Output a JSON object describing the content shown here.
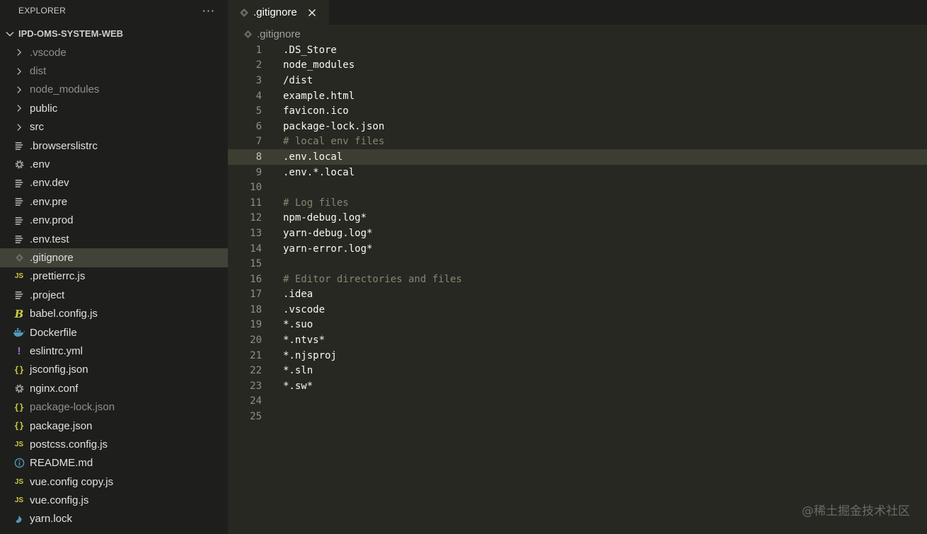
{
  "explorer": {
    "title": "EXPLORER",
    "more": "···",
    "project": "IPD-OMS-SYSTEM-WEB",
    "items": [
      {
        "label": ".vscode",
        "icon": "chevron-right-icon",
        "dim": true
      },
      {
        "label": "dist",
        "icon": "chevron-right-icon",
        "dim": true
      },
      {
        "label": "node_modules",
        "icon": "chevron-right-icon",
        "dim": true
      },
      {
        "label": "public",
        "icon": "chevron-right-icon",
        "dim": false
      },
      {
        "label": "src",
        "icon": "chevron-right-icon",
        "dim": false
      },
      {
        "label": ".browserslistrc",
        "icon": "lines-icon",
        "dim": false
      },
      {
        "label": ".env",
        "icon": "gear-icon",
        "dim": false
      },
      {
        "label": ".env.dev",
        "icon": "lines-icon",
        "dim": false
      },
      {
        "label": ".env.pre",
        "icon": "lines-icon",
        "dim": false
      },
      {
        "label": ".env.prod",
        "icon": "lines-icon",
        "dim": false
      },
      {
        "label": ".env.test",
        "icon": "lines-icon",
        "dim": false
      },
      {
        "label": ".gitignore",
        "icon": "git-diamond-icon",
        "dim": false,
        "selected": true
      },
      {
        "label": ".prettierrc.js",
        "icon": "js-icon",
        "dim": false
      },
      {
        "label": ".project",
        "icon": "lines-icon",
        "dim": false
      },
      {
        "label": "babel.config.js",
        "icon": "babel-icon",
        "dim": false
      },
      {
        "label": "Dockerfile",
        "icon": "docker-whale-icon",
        "dim": false
      },
      {
        "label": "eslintrc.yml",
        "icon": "exclamation-icon",
        "dim": false
      },
      {
        "label": "jsconfig.json",
        "icon": "json-braces-icon",
        "dim": false
      },
      {
        "label": "nginx.conf",
        "icon": "gear-icon",
        "dim": false
      },
      {
        "label": "package-lock.json",
        "icon": "json-braces-icon",
        "dim": true
      },
      {
        "label": "package.json",
        "icon": "json-braces-icon",
        "dim": false
      },
      {
        "label": "postcss.config.js",
        "icon": "js-icon",
        "dim": false
      },
      {
        "label": "README.md",
        "icon": "info-icon",
        "dim": false
      },
      {
        "label": "vue.config copy.js",
        "icon": "js-icon",
        "dim": false
      },
      {
        "label": "vue.config.js",
        "icon": "js-icon",
        "dim": false
      },
      {
        "label": "yarn.lock",
        "icon": "yarn-icon",
        "dim": false
      }
    ]
  },
  "icon_glyphs": {
    "js": "JS",
    "json": "{}",
    "bang": "!",
    "babel": "B"
  },
  "editor": {
    "tab_label": ".gitignore",
    "breadcrumb": ".gitignore",
    "current_line": 8,
    "lines": [
      {
        "n": "1",
        "text": ".DS_Store",
        "comment": false
      },
      {
        "n": "2",
        "text": "node_modules",
        "comment": false
      },
      {
        "n": "3",
        "text": "/dist",
        "comment": false
      },
      {
        "n": "4",
        "text": "example.html",
        "comment": false
      },
      {
        "n": "5",
        "text": "favicon.ico",
        "comment": false
      },
      {
        "n": "6",
        "text": "package-lock.json",
        "comment": false
      },
      {
        "n": "7",
        "text": "# local env files",
        "comment": true
      },
      {
        "n": "8",
        "text": ".env.local",
        "comment": false
      },
      {
        "n": "9",
        "text": ".env.*.local",
        "comment": false
      },
      {
        "n": "10",
        "text": "",
        "comment": false
      },
      {
        "n": "11",
        "text": "# Log files",
        "comment": true
      },
      {
        "n": "12",
        "text": "npm-debug.log*",
        "comment": false
      },
      {
        "n": "13",
        "text": "yarn-debug.log*",
        "comment": false
      },
      {
        "n": "14",
        "text": "yarn-error.log*",
        "comment": false
      },
      {
        "n": "15",
        "text": "",
        "comment": false
      },
      {
        "n": "16",
        "text": "# Editor directories and files",
        "comment": true
      },
      {
        "n": "17",
        "text": ".idea",
        "comment": false
      },
      {
        "n": "18",
        "text": ".vscode",
        "comment": false
      },
      {
        "n": "19",
        "text": "*.suo",
        "comment": false
      },
      {
        "n": "20",
        "text": "*.ntvs*",
        "comment": false
      },
      {
        "n": "21",
        "text": "*.njsproj",
        "comment": false
      },
      {
        "n": "22",
        "text": "*.sln",
        "comment": false
      },
      {
        "n": "23",
        "text": "*.sw*",
        "comment": false
      },
      {
        "n": "24",
        "text": "",
        "comment": false
      },
      {
        "n": "25",
        "text": "",
        "comment": false
      }
    ]
  },
  "watermark": "@稀土掘金技术社区",
  "colors": {
    "sidebar_bg": "#1e1f1c",
    "editor_bg": "#272822",
    "selection": "#414339",
    "current_line": "#3e3d32",
    "comment": "#88846f",
    "text": "#f8f8f2",
    "js_yellow": "#cbcb41",
    "yaml_purple": "#a074c4",
    "docker_blue": "#519aba"
  }
}
